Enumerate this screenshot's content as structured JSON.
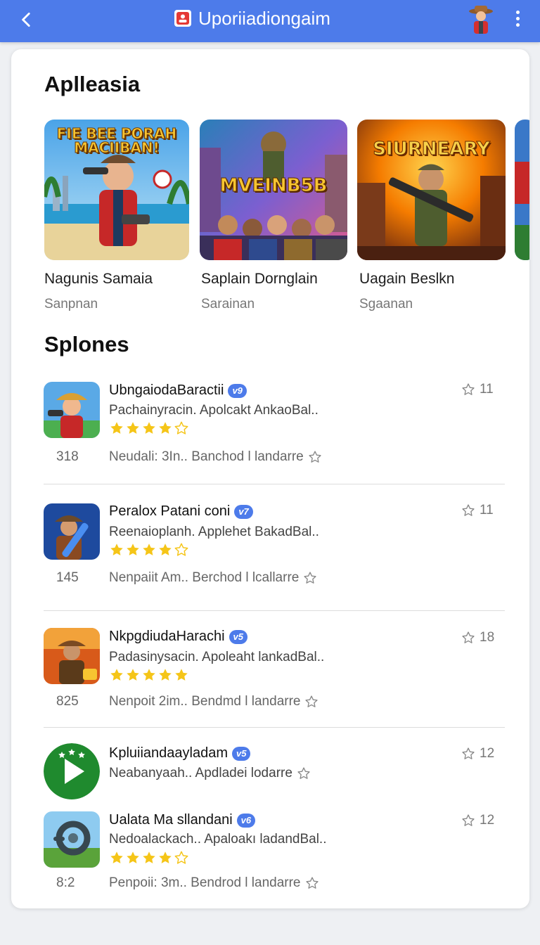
{
  "header": {
    "title": "Uporiiadiongaim",
    "back_icon": "chevron-left-icon",
    "app_icon": "user-badge-icon",
    "avatar_icon": "avatar",
    "menu_icon": "more-vertical-icon",
    "color": "#4d7bea"
  },
  "featured": {
    "title": "Aplleasia",
    "items": [
      {
        "image_text": "FIE BEE PORAH MACIIBAN!",
        "name": "Nagunis Samaia",
        "subtitle": "Sanpnan"
      },
      {
        "image_text": "MVEINB5B",
        "name": "Saplain Dornglain",
        "subtitle": "Sarainan"
      },
      {
        "image_text": "SIURNEARY",
        "name": "Uagain Beslkn",
        "subtitle": "Sgaanan"
      }
    ]
  },
  "list": {
    "title": "Splones",
    "items": [
      {
        "name": "UbngaiodaBaractii",
        "badge": "v9",
        "desc": "Pachainyracin. Apolcakt AnkaoBal..",
        "stars": 4,
        "count": "318",
        "meta": "Neudali: 3In.. Banchod l landarre",
        "rank": "11"
      },
      {
        "name": "Peralox Patani coni",
        "badge": "v7",
        "desc": "Reenaioplanh. Applehet BakadBal..",
        "stars": 4,
        "count": "145",
        "meta": "Nenpaiit Am.. Berchod l lcallarre",
        "rank": "11"
      },
      {
        "name": "NkpgdiudaHarachi",
        "badge": "v5",
        "desc": "Padasinysacin. Apoleaht lankadBal..",
        "stars": 5,
        "count": "825",
        "meta": "Nenpoit 2im.. Bendmd l landarre",
        "rank": "18"
      },
      {
        "name": "Kpluiiandaayladam",
        "badge": "v5",
        "desc": "Neabanyaah.. Apdladei lodarre",
        "stars": 0,
        "count": "",
        "meta": "",
        "rank": "12"
      },
      {
        "name": "Ualata Ma sllandani",
        "badge": "v6",
        "desc": "Nedoalackach.. Apaloakı ladandBal..",
        "stars": 4,
        "count": "8:2",
        "meta": "Penpoii: 3m.. Bendrod l landarre",
        "rank": "12"
      }
    ]
  },
  "colors": {
    "star": "#f5c518",
    "accent": "#4d7bea"
  }
}
